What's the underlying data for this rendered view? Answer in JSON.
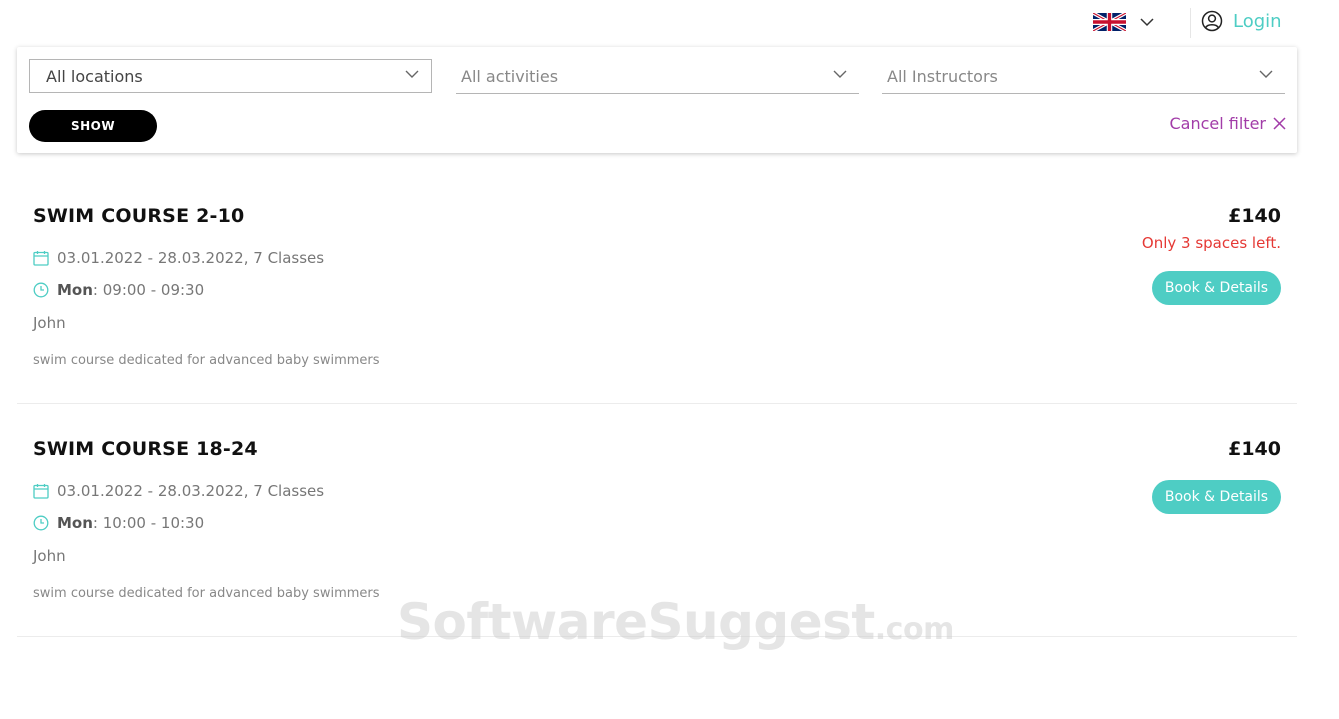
{
  "header": {
    "language_flag": "uk-flag-icon",
    "login_label": "Login",
    "accent_color": "#4ecdc4"
  },
  "filter": {
    "location_select": "All locations",
    "activity_select": "All activities",
    "instructor_select": "All Instructors",
    "show_button": "SHOW",
    "cancel_filter": "Cancel filter",
    "cancel_color": "#a23ca8"
  },
  "courses": [
    {
      "title": "SWIM COURSE 2-10",
      "dates": "03.01.2022 - 28.03.2022, 7 Classes",
      "day": "Mon",
      "time": ": 09:00 - 09:30",
      "instructor": "John",
      "description": "swim course dedicated for advanced baby swimmers",
      "price": "£140",
      "availability": "Only 3 spaces left.",
      "book_label": "Book & Details"
    },
    {
      "title": "SWIM COURSE 18-24",
      "dates": "03.01.2022 - 28.03.2022, 7 Classes",
      "day": "Mon",
      "time": ": 10:00 - 10:30",
      "instructor": "John",
      "description": "swim course dedicated for advanced baby swimmers",
      "price": "£140",
      "book_label": "Book & Details"
    }
  ],
  "watermark": {
    "name": "SoftwareSuggest",
    "suffix": ".com"
  }
}
